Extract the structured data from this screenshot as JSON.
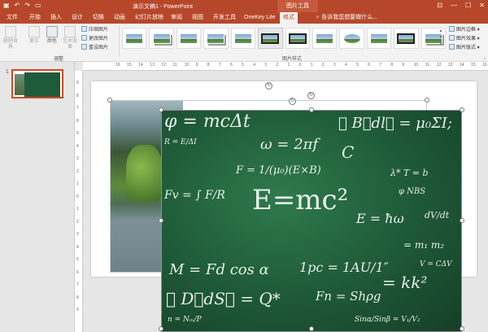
{
  "window": {
    "title": "演示文稿1 - PowerPoint",
    "context_title": "图片工具"
  },
  "qat": {
    "save_icon": "save-icon",
    "undo_icon": "undo-icon",
    "redo_icon": "redo-icon",
    "start_icon": "start-from-beginning-icon"
  },
  "window_controls": {
    "restore_icon": "restore-icon",
    "minimize": "—",
    "maximize": "☐",
    "close": "✕"
  },
  "tabs": [
    {
      "label": "文件"
    },
    {
      "label": "开始"
    },
    {
      "label": "插入"
    },
    {
      "label": "设计"
    },
    {
      "label": "切换"
    },
    {
      "label": "动画"
    },
    {
      "label": "幻灯片放映"
    },
    {
      "label": "审阅"
    },
    {
      "label": "视图"
    },
    {
      "label": "开发工具"
    },
    {
      "label": "OneKey Lite"
    },
    {
      "label": "格式"
    }
  ],
  "tell_me": "♀ 告诉我您想要做什么...",
  "ribbon": {
    "adjust": {
      "remove_bg": "删除背景",
      "corrections": "更正",
      "color": "颜色",
      "artistic": "艺术效果",
      "compress": "压缩图片",
      "change": "更改图片",
      "reset": "重设图片",
      "group_label": "调整"
    },
    "styles": {
      "group_label": "图片样式",
      "count": 12
    },
    "right": {
      "border": "图片边框",
      "effects": "图片效果",
      "layout": "图片版式"
    }
  },
  "slides": [
    {
      "number": "1"
    }
  ],
  "ruler": {
    "h": [
      "16",
      "15",
      "14",
      "13",
      "12",
      "11",
      "10",
      "9",
      "8",
      "7",
      "6",
      "5",
      "4",
      "3",
      "2",
      "1",
      "0",
      "1",
      "2",
      "3",
      "4",
      "5",
      "6",
      "7",
      "8",
      "9",
      "10",
      "11",
      "12",
      "13",
      "14",
      "15",
      "16"
    ],
    "v": [
      "9",
      "8",
      "7",
      "6",
      "5",
      "4",
      "3",
      "2",
      "1",
      "0",
      "1",
      "2",
      "3",
      "4",
      "5",
      "6",
      "7",
      "8",
      "9"
    ]
  },
  "blackboard": {
    "eq": {
      "phi": "φ = mcΔt",
      "emf": "∮ B⃗dl⃗ = μ₀ΣI;",
      "omega": "ω = 2πf",
      "c": "C",
      "emc": "E=mc²",
      "f": "F = 1/(μ₀)(E×B)",
      "fv": "Fv = ∫ F/R",
      "m": "M = Fd cos α",
      "pc": "1pc = 1AU/1″",
      "gauss": "∮ D⃗dS⃗ = Q*",
      "fn": "Fn = Shρg",
      "k": "= kk²",
      "hw": "E = ħω",
      "t": "λ* T = b",
      "v": "V = CΔV",
      "nbs": "φ NBS",
      "m2": "= m₁ m₂",
      "n": "n = Nₘ/P",
      "sin": "Sinα/Sinβ = V₁/V₂",
      "r": "R = E/ΔI",
      "dv": "dV/dt"
    }
  }
}
